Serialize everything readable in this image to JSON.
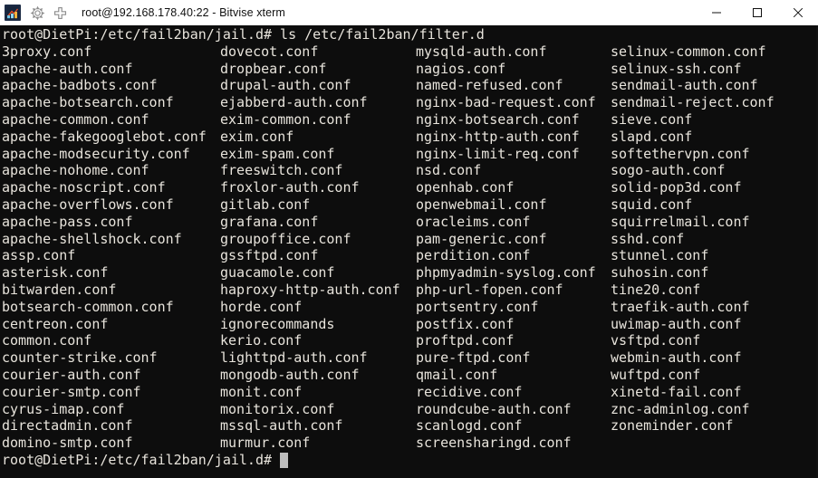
{
  "window": {
    "title": "root@192.168.178.40:22 - Bitvise xterm",
    "icons": {
      "app": "bitvise-logo-icon",
      "gear": "gear-icon",
      "new_tab": "plus-icon",
      "minimize": "minimize-icon",
      "maximize": "maximize-icon",
      "close": "close-icon"
    },
    "colors": {
      "titlebar_bg": "#ffffff",
      "titlebar_text": "#101010",
      "terminal_bg": "#0d0d0d",
      "terminal_text": "#e8e4dc",
      "cursor": "#bdbdbd"
    }
  },
  "terminal": {
    "prompt": "root@DietPi:/etc/fail2ban/jail.d#",
    "command": "ls /etc/fail2ban/filter.d",
    "command_line": "root@DietPi:/etc/fail2ban/jail.d# ls /etc/fail2ban/filter.d",
    "final_prompt": "root@DietPi:/etc/fail2ban/jail.d#",
    "cursor_visible": true,
    "columns": [
      [
        "3proxy.conf",
        "apache-auth.conf",
        "apache-badbots.conf",
        "apache-botsearch.conf",
        "apache-common.conf",
        "apache-fakegooglebot.conf",
        "apache-modsecurity.conf",
        "apache-nohome.conf",
        "apache-noscript.conf",
        "apache-overflows.conf",
        "apache-pass.conf",
        "apache-shellshock.conf",
        "assp.conf",
        "asterisk.conf",
        "bitwarden.conf",
        "botsearch-common.conf",
        "centreon.conf",
        "common.conf",
        "counter-strike.conf",
        "courier-auth.conf",
        "courier-smtp.conf",
        "cyrus-imap.conf",
        "directadmin.conf",
        "domino-smtp.conf"
      ],
      [
        "dovecot.conf",
        "dropbear.conf",
        "drupal-auth.conf",
        "ejabberd-auth.conf",
        "exim-common.conf",
        "exim.conf",
        "exim-spam.conf",
        "freeswitch.conf",
        "froxlor-auth.conf",
        "gitlab.conf",
        "grafana.conf",
        "groupoffice.conf",
        "gssftpd.conf",
        "guacamole.conf",
        "haproxy-http-auth.conf",
        "horde.conf",
        "ignorecommands",
        "kerio.conf",
        "lighttpd-auth.conf",
        "mongodb-auth.conf",
        "monit.conf",
        "monitorix.conf",
        "mssql-auth.conf",
        "murmur.conf"
      ],
      [
        "mysqld-auth.conf",
        "nagios.conf",
        "named-refused.conf",
        "nginx-bad-request.conf",
        "nginx-botsearch.conf",
        "nginx-http-auth.conf",
        "nginx-limit-req.conf",
        "nsd.conf",
        "openhab.conf",
        "openwebmail.conf",
        "oracleims.conf",
        "pam-generic.conf",
        "perdition.conf",
        "phpmyadmin-syslog.conf",
        "php-url-fopen.conf",
        "portsentry.conf",
        "postfix.conf",
        "proftpd.conf",
        "pure-ftpd.conf",
        "qmail.conf",
        "recidive.conf",
        "roundcube-auth.conf",
        "scanlogd.conf",
        "screensharingd.conf"
      ],
      [
        "selinux-common.conf",
        "selinux-ssh.conf",
        "sendmail-auth.conf",
        "sendmail-reject.conf",
        "sieve.conf",
        "slapd.conf",
        "softethervpn.conf",
        "sogo-auth.conf",
        "solid-pop3d.conf",
        "squid.conf",
        "squirrelmail.conf",
        "sshd.conf",
        "stunnel.conf",
        "suhosin.conf",
        "tine20.conf",
        "traefik-auth.conf",
        "uwimap-auth.conf",
        "vsftpd.conf",
        "webmin-auth.conf",
        "wuftpd.conf",
        "xinetd-fail.conf",
        "znc-adminlog.conf",
        "zoneminder.conf"
      ]
    ]
  }
}
